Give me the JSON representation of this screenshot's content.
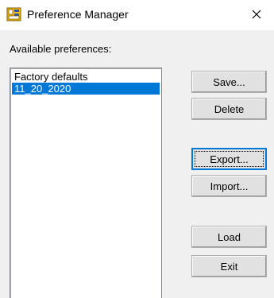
{
  "window": {
    "title": "Preference Manager",
    "app_icon": "preference-app-icon",
    "close_glyph": "close-icon"
  },
  "preferences": {
    "group_label": "Available preferences:",
    "items": [
      {
        "label": "Factory defaults",
        "selected": false
      },
      {
        "label": "11_20_2020",
        "selected": true
      }
    ]
  },
  "buttons": {
    "save": "Save...",
    "delete": "Delete",
    "export": "Export...",
    "import": "Import...",
    "load": "Load",
    "exit": "Exit"
  },
  "colors": {
    "selection": "#0078d7",
    "window_bg": "#f0f0f0",
    "titlebar_bg": "#ffffff"
  }
}
